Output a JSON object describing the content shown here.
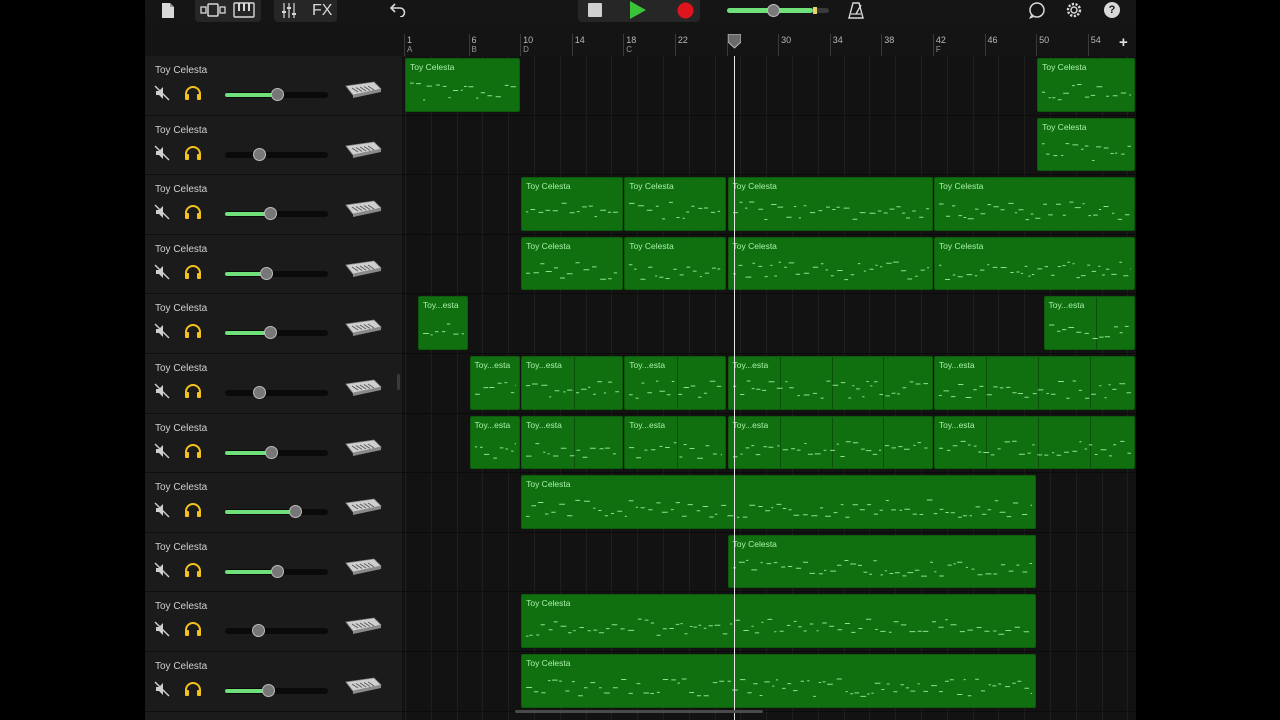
{
  "toolbar": {
    "fx_label": "FX",
    "icons": [
      "document-icon",
      "track-view-icon",
      "keyboard-icon",
      "mixer-icon",
      "undo-icon",
      "stop-icon",
      "play-icon",
      "record-icon",
      "master-volume-slider",
      "metronome-icon",
      "loop-icon",
      "settings-icon",
      "help-icon"
    ],
    "colors": {
      "play": "#3ac43a",
      "record": "#e0141c",
      "accent": "#6fe07a"
    },
    "help_label": "?"
  },
  "ruler": {
    "bars": [
      "1",
      "6",
      "10",
      "14",
      "18",
      "22",
      "26",
      "30",
      "34",
      "38",
      "42",
      "46",
      "50",
      "54"
    ],
    "markers": [
      "A",
      "B",
      "D",
      "C",
      "F"
    ],
    "playhead_bar": "26",
    "add_label": "+"
  },
  "tracks": [
    {
      "name": "Toy Celesta",
      "volume": 0.5
    },
    {
      "name": "Toy Celesta",
      "volume": 0.33
    },
    {
      "name": "Toy Celesta",
      "volume": 0.44
    },
    {
      "name": "Toy Celesta",
      "volume": 0.4
    },
    {
      "name": "Toy Celesta",
      "volume": 0.44
    },
    {
      "name": "Toy Celesta",
      "volume": 0.33
    },
    {
      "name": "Toy Celesta",
      "volume": 0.45
    },
    {
      "name": "Toy Celesta",
      "volume": 0.68
    },
    {
      "name": "Toy Celesta",
      "volume": 0.5
    },
    {
      "name": "Toy Celesta",
      "volume": 0.32
    },
    {
      "name": "Toy Celesta",
      "volume": 0.42
    }
  ],
  "regions": [
    {
      "track": 0,
      "start": 1,
      "end": 10,
      "label": "Toy Celesta"
    },
    {
      "track": 0,
      "start": 50,
      "end": 58.5,
      "label": "Toy Celesta"
    },
    {
      "track": 1,
      "start": 50,
      "end": 58.5,
      "label": "Toy Celesta"
    },
    {
      "track": 2,
      "start": 10,
      "end": 18,
      "label": "Toy Celesta"
    },
    {
      "track": 2,
      "start": 18,
      "end": 26,
      "label": "Toy Celesta"
    },
    {
      "track": 2,
      "start": 26,
      "end": 42,
      "label": "Toy Celesta"
    },
    {
      "track": 2,
      "start": 42,
      "end": 58.5,
      "label": "Toy Celesta"
    },
    {
      "track": 3,
      "start": 10,
      "end": 18,
      "label": "Toy Celesta"
    },
    {
      "track": 3,
      "start": 18,
      "end": 26,
      "label": "Toy Celesta"
    },
    {
      "track": 3,
      "start": 26,
      "end": 42,
      "label": "Toy Celesta"
    },
    {
      "track": 3,
      "start": 42,
      "end": 58.5,
      "label": "Toy Celesta"
    },
    {
      "track": 4,
      "start": 2,
      "end": 6,
      "label": "Toy...esta"
    },
    {
      "track": 4,
      "start": 50.5,
      "end": 58.5,
      "label": "Toy...esta"
    },
    {
      "track": 5,
      "start": 6,
      "end": 10,
      "label": "Toy...esta"
    },
    {
      "track": 5,
      "start": 10,
      "end": 18,
      "label": "Toy...esta"
    },
    {
      "track": 5,
      "start": 18,
      "end": 26,
      "label": "Toy...esta"
    },
    {
      "track": 5,
      "start": 26,
      "end": 42,
      "label": "Toy...esta"
    },
    {
      "track": 5,
      "start": 42,
      "end": 58.5,
      "label": "Toy...esta"
    },
    {
      "track": 6,
      "start": 6,
      "end": 10,
      "label": "Toy...esta"
    },
    {
      "track": 6,
      "start": 10,
      "end": 18,
      "label": "Toy...esta"
    },
    {
      "track": 6,
      "start": 18,
      "end": 26,
      "label": "Toy...esta"
    },
    {
      "track": 6,
      "start": 26,
      "end": 42,
      "label": "Toy...esta"
    },
    {
      "track": 6,
      "start": 42,
      "end": 58.5,
      "label": "Toy...esta"
    },
    {
      "track": 7,
      "start": 10,
      "end": 50,
      "label": "Toy Celesta"
    },
    {
      "track": 8,
      "start": 26,
      "end": 50,
      "label": "Toy Celesta"
    },
    {
      "track": 9,
      "start": 10,
      "end": 50,
      "label": "Toy Celesta"
    },
    {
      "track": 10,
      "start": 10,
      "end": 50,
      "label": "Toy Celesta"
    }
  ]
}
